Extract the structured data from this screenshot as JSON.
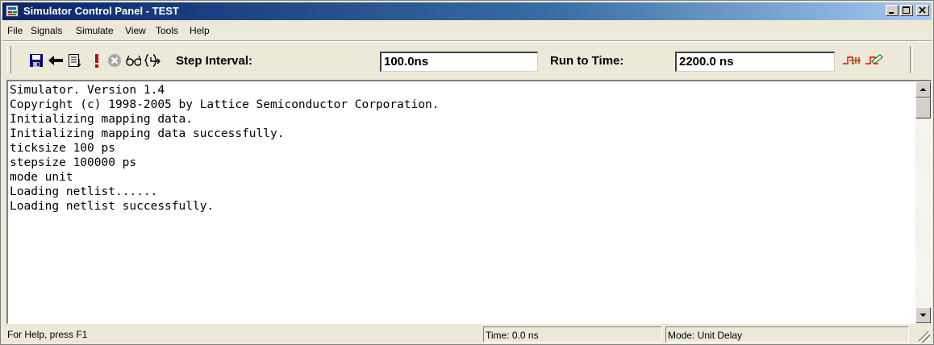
{
  "window": {
    "title": "Simulator Control Panel - TEST"
  },
  "menu": [
    "File",
    "Signals",
    "Simulate",
    "View",
    "Tools",
    "Help"
  ],
  "toolbar": {
    "icons": [
      "save-icon",
      "back-arrow-icon",
      "list-icon",
      "exclamation-icon",
      "stop-icon",
      "glasses-icon",
      "step-into-icon",
      "waveform-icon",
      "waveform-edit-icon"
    ],
    "step_interval_label": "Step Interval:",
    "step_interval_value": "100.0ns",
    "run_to_time_label": "Run to Time:",
    "run_to_time_value": "2200.0 ns"
  },
  "console": {
    "lines": [
      "Simulator. Version 1.4",
      "Copyright (c) 1998-2005 by Lattice Semiconductor Corporation.",
      "Initializing mapping data.",
      "Initializing mapping data successfully.",
      "ticksize 100 ps",
      "stepsize 100000 ps",
      "mode unit",
      "Loading netlist......",
      "Loading netlist successfully."
    ]
  },
  "status": {
    "help": "For Help, press F1",
    "time": "Time: 0.0 ns",
    "mode": "Mode: Unit Delay"
  }
}
